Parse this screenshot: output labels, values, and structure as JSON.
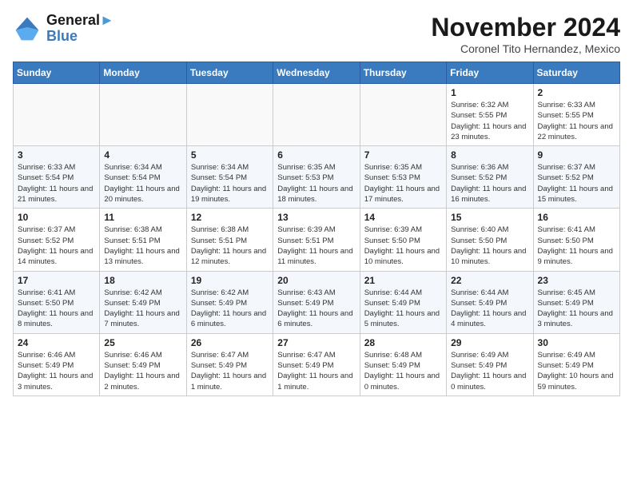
{
  "header": {
    "logo_line1": "General",
    "logo_line2": "Blue",
    "month_title": "November 2024",
    "subtitle": "Coronel Tito Hernandez, Mexico"
  },
  "weekdays": [
    "Sunday",
    "Monday",
    "Tuesday",
    "Wednesday",
    "Thursday",
    "Friday",
    "Saturday"
  ],
  "weeks": [
    [
      {
        "day": "",
        "info": ""
      },
      {
        "day": "",
        "info": ""
      },
      {
        "day": "",
        "info": ""
      },
      {
        "day": "",
        "info": ""
      },
      {
        "day": "",
        "info": ""
      },
      {
        "day": "1",
        "info": "Sunrise: 6:32 AM\nSunset: 5:55 PM\nDaylight: 11 hours\nand 23 minutes."
      },
      {
        "day": "2",
        "info": "Sunrise: 6:33 AM\nSunset: 5:55 PM\nDaylight: 11 hours\nand 22 minutes."
      }
    ],
    [
      {
        "day": "3",
        "info": "Sunrise: 6:33 AM\nSunset: 5:54 PM\nDaylight: 11 hours\nand 21 minutes."
      },
      {
        "day": "4",
        "info": "Sunrise: 6:34 AM\nSunset: 5:54 PM\nDaylight: 11 hours\nand 20 minutes."
      },
      {
        "day": "5",
        "info": "Sunrise: 6:34 AM\nSunset: 5:54 PM\nDaylight: 11 hours\nand 19 minutes."
      },
      {
        "day": "6",
        "info": "Sunrise: 6:35 AM\nSunset: 5:53 PM\nDaylight: 11 hours\nand 18 minutes."
      },
      {
        "day": "7",
        "info": "Sunrise: 6:35 AM\nSunset: 5:53 PM\nDaylight: 11 hours\nand 17 minutes."
      },
      {
        "day": "8",
        "info": "Sunrise: 6:36 AM\nSunset: 5:52 PM\nDaylight: 11 hours\nand 16 minutes."
      },
      {
        "day": "9",
        "info": "Sunrise: 6:37 AM\nSunset: 5:52 PM\nDaylight: 11 hours\nand 15 minutes."
      }
    ],
    [
      {
        "day": "10",
        "info": "Sunrise: 6:37 AM\nSunset: 5:52 PM\nDaylight: 11 hours\nand 14 minutes."
      },
      {
        "day": "11",
        "info": "Sunrise: 6:38 AM\nSunset: 5:51 PM\nDaylight: 11 hours\nand 13 minutes."
      },
      {
        "day": "12",
        "info": "Sunrise: 6:38 AM\nSunset: 5:51 PM\nDaylight: 11 hours\nand 12 minutes."
      },
      {
        "day": "13",
        "info": "Sunrise: 6:39 AM\nSunset: 5:51 PM\nDaylight: 11 hours\nand 11 minutes."
      },
      {
        "day": "14",
        "info": "Sunrise: 6:39 AM\nSunset: 5:50 PM\nDaylight: 11 hours\nand 10 minutes."
      },
      {
        "day": "15",
        "info": "Sunrise: 6:40 AM\nSunset: 5:50 PM\nDaylight: 11 hours\nand 10 minutes."
      },
      {
        "day": "16",
        "info": "Sunrise: 6:41 AM\nSunset: 5:50 PM\nDaylight: 11 hours\nand 9 minutes."
      }
    ],
    [
      {
        "day": "17",
        "info": "Sunrise: 6:41 AM\nSunset: 5:50 PM\nDaylight: 11 hours\nand 8 minutes."
      },
      {
        "day": "18",
        "info": "Sunrise: 6:42 AM\nSunset: 5:49 PM\nDaylight: 11 hours\nand 7 minutes."
      },
      {
        "day": "19",
        "info": "Sunrise: 6:42 AM\nSunset: 5:49 PM\nDaylight: 11 hours\nand 6 minutes."
      },
      {
        "day": "20",
        "info": "Sunrise: 6:43 AM\nSunset: 5:49 PM\nDaylight: 11 hours\nand 6 minutes."
      },
      {
        "day": "21",
        "info": "Sunrise: 6:44 AM\nSunset: 5:49 PM\nDaylight: 11 hours\nand 5 minutes."
      },
      {
        "day": "22",
        "info": "Sunrise: 6:44 AM\nSunset: 5:49 PM\nDaylight: 11 hours\nand 4 minutes."
      },
      {
        "day": "23",
        "info": "Sunrise: 6:45 AM\nSunset: 5:49 PM\nDaylight: 11 hours\nand 3 minutes."
      }
    ],
    [
      {
        "day": "24",
        "info": "Sunrise: 6:46 AM\nSunset: 5:49 PM\nDaylight: 11 hours\nand 3 minutes."
      },
      {
        "day": "25",
        "info": "Sunrise: 6:46 AM\nSunset: 5:49 PM\nDaylight: 11 hours\nand 2 minutes."
      },
      {
        "day": "26",
        "info": "Sunrise: 6:47 AM\nSunset: 5:49 PM\nDaylight: 11 hours\nand 1 minute."
      },
      {
        "day": "27",
        "info": "Sunrise: 6:47 AM\nSunset: 5:49 PM\nDaylight: 11 hours\nand 1 minute."
      },
      {
        "day": "28",
        "info": "Sunrise: 6:48 AM\nSunset: 5:49 PM\nDaylight: 11 hours\nand 0 minutes."
      },
      {
        "day": "29",
        "info": "Sunrise: 6:49 AM\nSunset: 5:49 PM\nDaylight: 11 hours\nand 0 minutes."
      },
      {
        "day": "30",
        "info": "Sunrise: 6:49 AM\nSunset: 5:49 PM\nDaylight: 10 hours\nand 59 minutes."
      }
    ]
  ]
}
